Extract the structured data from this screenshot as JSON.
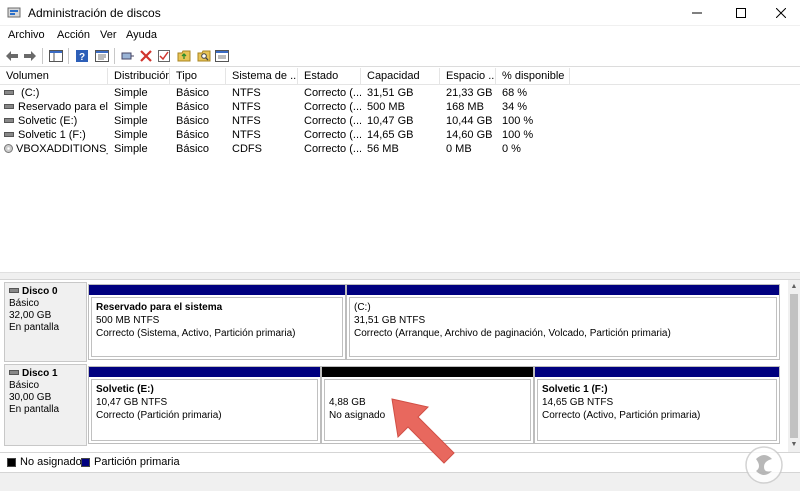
{
  "window": {
    "title": "Administración de discos"
  },
  "menu": [
    "Archivo",
    "Acción",
    "Ver",
    "Ayuda"
  ],
  "toolbar": {
    "icons": [
      "back-icon",
      "forward-icon",
      "console-tree-icon",
      "help-icon",
      "properties-icon",
      "connect-icon",
      "delete-icon",
      "checklist-icon",
      "folder-up-icon",
      "search-folder-icon",
      "export-list-icon"
    ]
  },
  "columns": [
    "Volumen",
    "Distribución",
    "Tipo",
    "Sistema de ...",
    "Estado",
    "Capacidad",
    "Espacio ...",
    "% disponible"
  ],
  "volumes": [
    {
      "name": " (C:)",
      "layout": "Simple",
      "type": "Básico",
      "fs": "NTFS",
      "status": "Correcto (...",
      "capacity": "31,51 GB",
      "free": "21,33 GB",
      "pct": "68 %",
      "icon": "volume-icon"
    },
    {
      "name": "Reservado para el ...",
      "layout": "Simple",
      "type": "Básico",
      "fs": "NTFS",
      "status": "Correcto (...",
      "capacity": "500 MB",
      "free": "168 MB",
      "pct": "34 %",
      "icon": "volume-icon"
    },
    {
      "name": "Solvetic (E:)",
      "layout": "Simple",
      "type": "Básico",
      "fs": "NTFS",
      "status": "Correcto (...",
      "capacity": "10,47 GB",
      "free": "10,44 GB",
      "pct": "100 %",
      "icon": "volume-icon"
    },
    {
      "name": "Solvetic 1 (F:)",
      "layout": "Simple",
      "type": "Básico",
      "fs": "NTFS",
      "status": "Correcto (...",
      "capacity": "14,65 GB",
      "free": "14,60 GB",
      "pct": "100 %",
      "icon": "volume-icon"
    },
    {
      "name": "VBOXADDITIONS_...",
      "layout": "Simple",
      "type": "Básico",
      "fs": "CDFS",
      "status": "Correcto (...",
      "capacity": "56 MB",
      "free": "0 MB",
      "pct": "0 %",
      "icon": "cd-drive-icon"
    }
  ],
  "disks": [
    {
      "name": "Disco 0",
      "type": "Básico",
      "size": "32,00 GB",
      "state": "En pantalla",
      "partitions": [
        {
          "title": "Reservado para el sistema",
          "size": "500 MB NTFS",
          "status": "Correcto (Sistema, Activo, Partición primaria)",
          "kind": "primary"
        },
        {
          "title": "(C:)",
          "size": "31,51 GB NTFS",
          "status": "Correcto (Arranque, Archivo de paginación, Volcado, Partición primaria)",
          "kind": "primary"
        }
      ]
    },
    {
      "name": "Disco 1",
      "type": "Básico",
      "size": "30,00 GB",
      "state": "En pantalla",
      "partitions": [
        {
          "title": "Solvetic  (E:)",
          "size": "10,47 GB NTFS",
          "status": "Correcto (Partición primaria)",
          "kind": "primary"
        },
        {
          "title": "",
          "size": "4,88 GB",
          "status": "No asignado",
          "kind": "unallocated"
        },
        {
          "title": "Solvetic 1  (F:)",
          "size": "14,65 GB NTFS",
          "status": "Correcto (Activo, Partición primaria)",
          "kind": "primary"
        }
      ]
    }
  ],
  "legend": [
    {
      "label": "No asignado",
      "color": "#000000"
    },
    {
      "label": "Partición primaria",
      "color": "#00007f"
    }
  ],
  "colors": {
    "primary": "#00007f",
    "unallocated": "#000000",
    "arrow": "#e8685e"
  }
}
